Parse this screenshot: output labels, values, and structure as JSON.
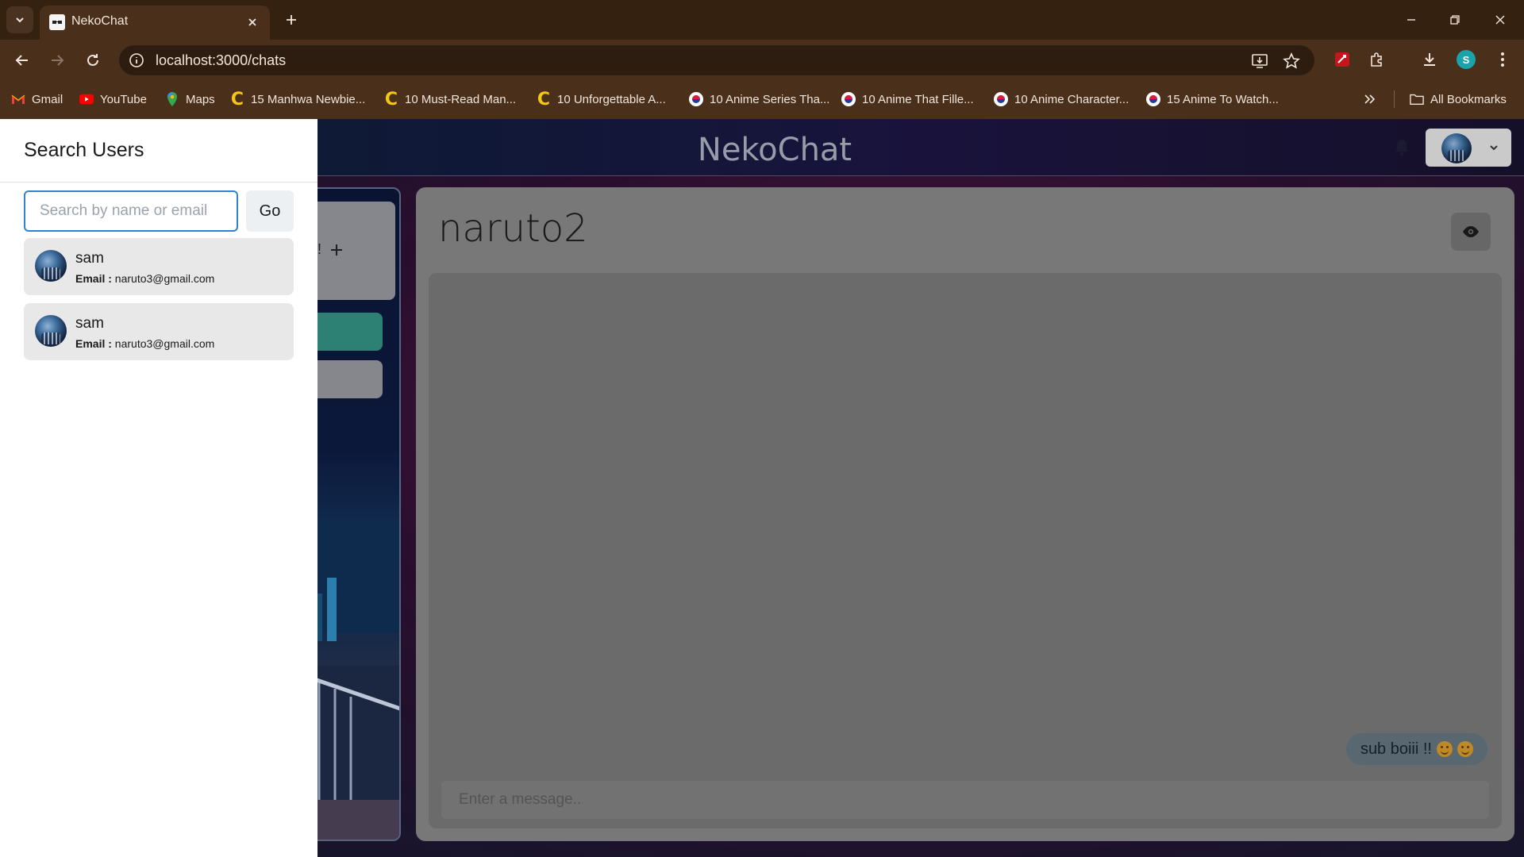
{
  "browser": {
    "tab_title": "NekoChat",
    "url": "localhost:3000/chats",
    "profile_initial": "S",
    "bookmarks": [
      {
        "label": "Gmail",
        "icon": "gmail-icon"
      },
      {
        "label": "YouTube",
        "icon": "youtube-icon"
      },
      {
        "label": "Maps",
        "icon": "maps-icon"
      },
      {
        "label": "15 Manhwa Newbie...",
        "icon": "c-icon"
      },
      {
        "label": "10 Must-Read Man...",
        "icon": "c-icon"
      },
      {
        "label": "10 Unforgettable A...",
        "icon": "c-icon"
      },
      {
        "label": "10 Anime Series Tha...",
        "icon": "site-icon"
      },
      {
        "label": "10 Anime That Fille...",
        "icon": "site-icon"
      },
      {
        "label": "10 Anime Character...",
        "icon": "site-icon"
      },
      {
        "label": "15 Anime To Watch...",
        "icon": "site-icon"
      }
    ],
    "all_bookmarks_label": "All Bookmarks"
  },
  "app": {
    "title": "NekoChat"
  },
  "drawer": {
    "title": "Search Users",
    "search_placeholder": "Search by name or email",
    "go_label": "Go",
    "results": [
      {
        "name": "sam",
        "email_label": "Email :",
        "email": "naruto3@gmail.com"
      },
      {
        "name": "sam",
        "email_label": "Email :",
        "email": "naruto3@gmail.com"
      }
    ]
  },
  "chat_list": {
    "create_label_partial": "ild!"
  },
  "chat": {
    "title": "naruto2",
    "messages": [
      {
        "text": "sub boiii !!",
        "emojis": [
          "smiling-face-icon",
          "smiling-face-icon"
        ]
      }
    ],
    "input_placeholder": "Enter a message.."
  },
  "colors": {
    "accent": "#3182ce",
    "active_chat": "#2f8a7c",
    "chrome_bg": "#4a2f1b"
  }
}
